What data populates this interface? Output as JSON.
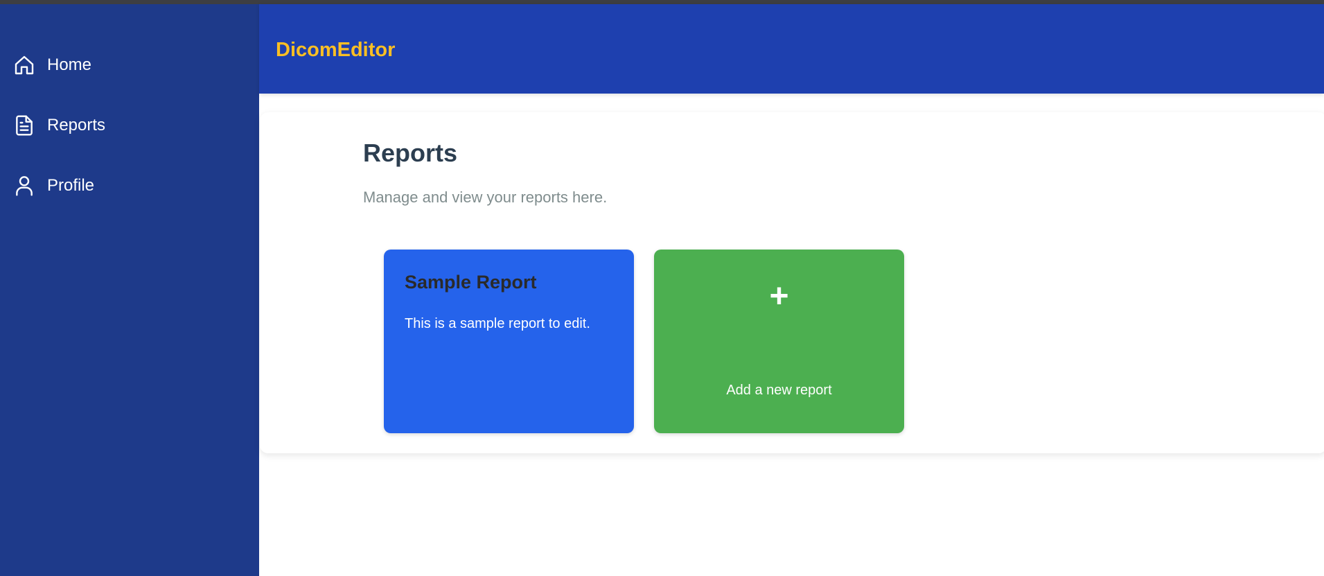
{
  "app": {
    "brand": "DicomEditor"
  },
  "sidebar": {
    "items": [
      {
        "label": "Home",
        "icon": "home-icon"
      },
      {
        "label": "Reports",
        "icon": "document-icon"
      },
      {
        "label": "Profile",
        "icon": "user-icon"
      }
    ]
  },
  "main": {
    "title": "Reports",
    "subtitle": "Manage and view your reports here.",
    "cards": [
      {
        "title": "Sample Report",
        "description": "This is a sample report to edit."
      }
    ],
    "add_card": {
      "symbol": "+",
      "label": "Add a new report"
    }
  },
  "colors": {
    "sidebar": "#1e3a8a",
    "header": "#1e40af",
    "brand": "#fbbf24",
    "report_card": "#2563eb",
    "add_card": "#4caf50"
  }
}
